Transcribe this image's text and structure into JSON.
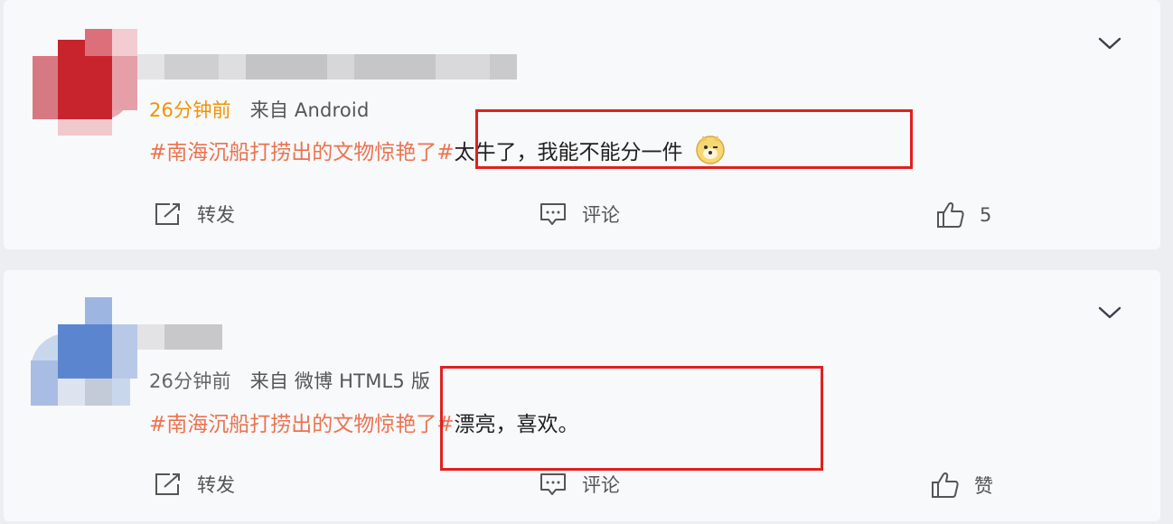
{
  "posts": [
    {
      "time": "26分钟前",
      "source": "来自 Android",
      "topic": "#南海沉船打捞出的文物惊艳了#",
      "text": "太牛了，我能不能分一件",
      "emoji_icon": "doge-emoji-icon",
      "actions": {
        "repost_label": "转发",
        "comment_label": "评论",
        "like_label": "5"
      }
    },
    {
      "time": "26分钟前",
      "source": "来自 微博 HTML5 版",
      "topic": "#南海沉船打捞出的文物惊艳了#",
      "text": "漂亮，喜欢。",
      "actions": {
        "repost_label": "转发",
        "comment_label": "评论",
        "like_label": "赞"
      }
    }
  ],
  "colors": {
    "topic": "#eb7350",
    "highlight_box": "#e02020",
    "time_highlight": "#f29100"
  }
}
